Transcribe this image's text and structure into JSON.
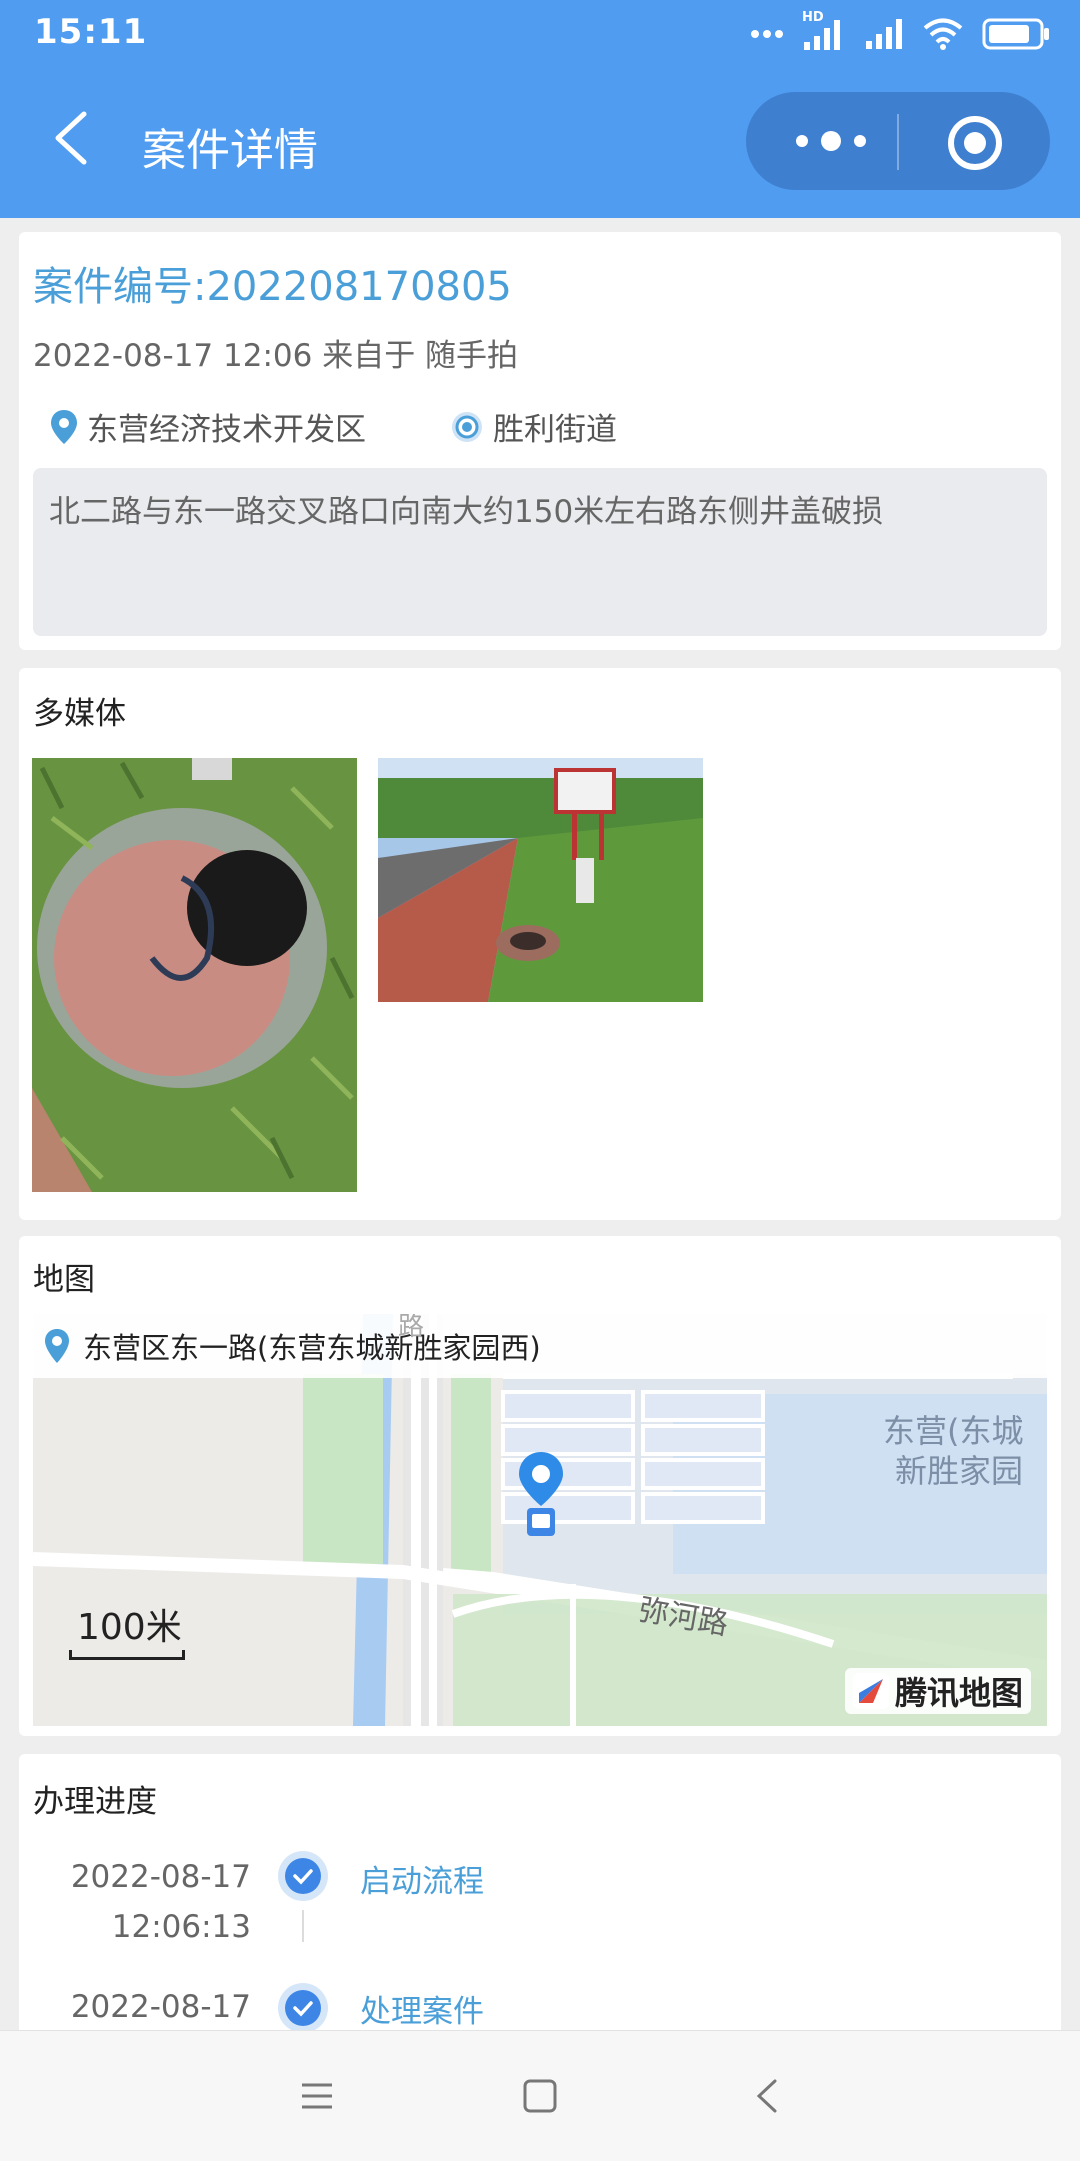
{
  "status_bar": {
    "time": "15:11",
    "network_badge": "HD"
  },
  "header": {
    "title": "案件详情",
    "back_icon": "back-arrow-icon"
  },
  "case": {
    "number": "案件编号:202208170805",
    "meta": "2022-08-17 12:06 来自于 随手拍",
    "district": "东营经济技术开发区",
    "street": "胜利街道",
    "description": "北二路与东一路交叉路口向南大约150米左右路东侧井盖破损"
  },
  "media": {
    "title": "多媒体"
  },
  "map": {
    "title": "地图",
    "address": "东营区东一路(东营东城新胜家园西)",
    "road_label": "弥河路",
    "area_label_1": "东营(东城",
    "area_label_2": "新胜家园",
    "road_top": "路",
    "scale": "100米",
    "provider": "腾讯地图"
  },
  "progress": {
    "title": "办理进度",
    "steps": [
      {
        "date": "2022-08-17",
        "time": "12:06:13",
        "label": "启动流程"
      },
      {
        "date": "2022-08-17",
        "time": "",
        "label": "处理案件"
      }
    ]
  },
  "colors": {
    "header": "#4f9cf0",
    "accent": "#4a9fd8",
    "check": "#3d86e6"
  }
}
